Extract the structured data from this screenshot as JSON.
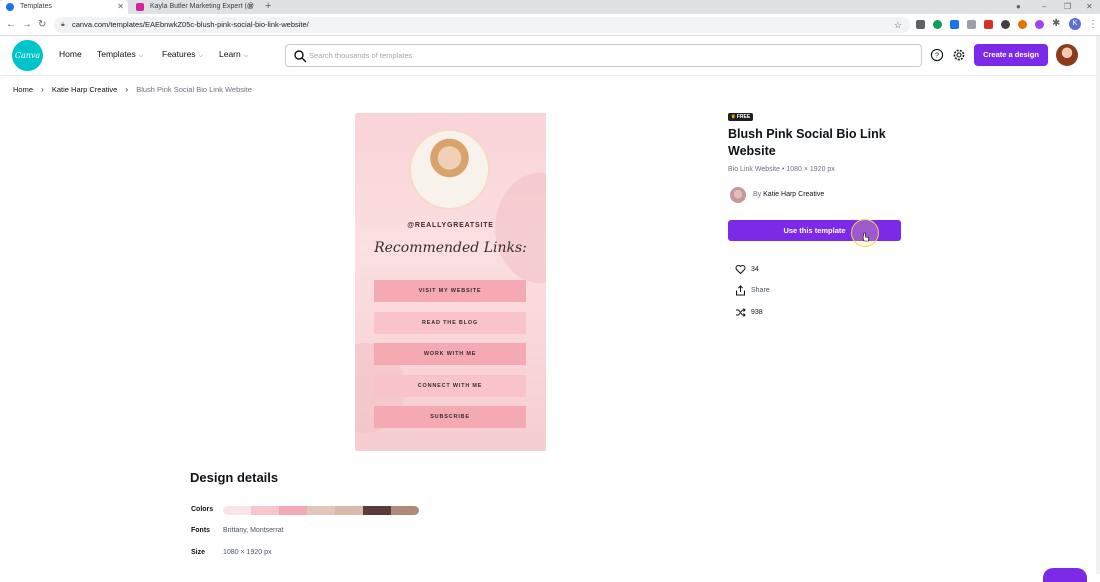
{
  "browser": {
    "tabs": [
      {
        "label": "Templates",
        "favicon_color": "#1a73e8"
      },
      {
        "label": "Kayla Butler Marketing Expert (@",
        "favicon_color": "#d6249f"
      }
    ],
    "new_tab": "+",
    "url": "canva.com/templates/EAEbnwkZ05c-blush-pink-social-bio-link-website/",
    "extension_colors": [
      "#5f6368",
      "#0f9d58",
      "#1a73e8",
      "#9aa0a6",
      "#d93025",
      "#3c4043",
      "#e37400",
      "#a142f4",
      "#5f6368",
      "#5f6368"
    ],
    "profile_initial": "K"
  },
  "header": {
    "logo_text": "Canva",
    "nav": [
      {
        "label": "Home"
      },
      {
        "label": "Templates"
      },
      {
        "label": "Features"
      },
      {
        "label": "Learn"
      }
    ],
    "search_placeholder": "Search thousands of templates",
    "create_button": "Create a design"
  },
  "breadcrumb": [
    "Home",
    "Katie Harp Creative",
    "Blush Pink Social Bio Link Website"
  ],
  "preview": {
    "handle": "@REALLYGREATSITE",
    "script_title": "Recommended Links:",
    "links": [
      "VISIT MY WEBSITE",
      "READ THE BLOG",
      "WORK WITH ME",
      "CONNECT WITH ME",
      "SUBSCRIBE"
    ]
  },
  "info": {
    "badge": "FREE",
    "title": "Blush Pink Social Bio Link Website",
    "subtitle": "Bio Link Website • 1080 × 1920 px",
    "author_prefix": "By",
    "author_name": "Katie Harp Creative",
    "use_button": "Use this template",
    "likes": "34",
    "share": "Share",
    "remixes": "938"
  },
  "design_details": {
    "title": "Design details",
    "colors_label": "Colors",
    "colors": [
      "#fbe4e6",
      "#f6c6cb",
      "#f1aab3",
      "#e2c7b8",
      "#d7bcac",
      "#5a3d3a",
      "#b08a7a"
    ],
    "fonts_label": "Fonts",
    "fonts": "Brittany, Montserrat",
    "size_label": "Size",
    "size": "1080 × 1920 px"
  },
  "accent_color": "#7d2ae8"
}
